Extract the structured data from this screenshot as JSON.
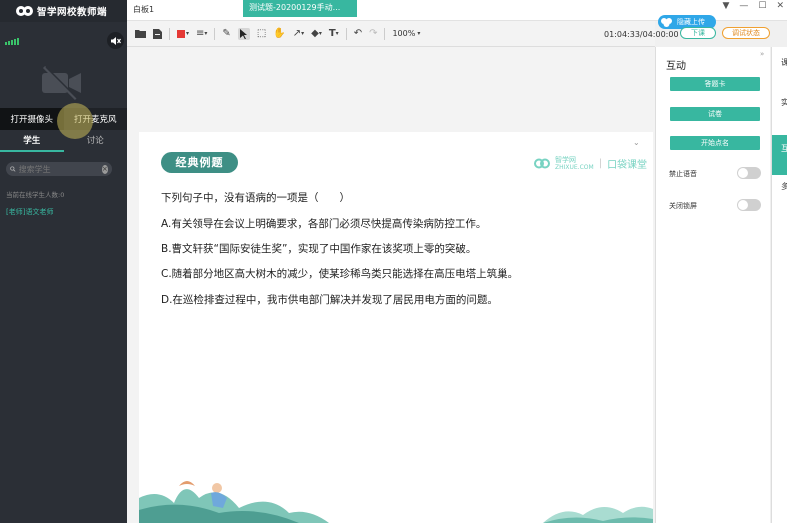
{
  "app": {
    "title": "智学网校教师端"
  },
  "left": {
    "camera_btn": "打开摄像头",
    "mic_btn": "打开麦克风",
    "tab_students": "学生",
    "tab_discuss": "讨论",
    "search_placeholder": "搜索学生",
    "online_count": "当前在线学生人数:0",
    "teacher_name": "[老师]语文老师"
  },
  "top": {
    "board_tab": "白板1",
    "file_tab": "测试题-20200129手动..."
  },
  "toolbar": {
    "zoom": "100%",
    "timer": "01:04:33/04:00:00",
    "hidden_btn": "隐藏上传",
    "download_btn": "下课",
    "status_btn": "调试状态"
  },
  "slide": {
    "badge": "经典例题",
    "brand_name": "智学网",
    "brand_sub": "ZHIXUE.COM",
    "brand_program": "口袋课堂",
    "question": "下列句子中，没有语病的一项是（　　）",
    "options": [
      "A.有关领导在会议上明确要求，各部门必须尽快提高传染病防控工作。",
      "B.曹文轩获“国际安徒生奖”，实现了中国作家在该奖项上零的突破。",
      "C.随着部分地区高大树木的减少，使某珍稀鸟类只能选择在高压电塔上筑巢。",
      "D.在巡检排查过程中，我市供电部门解决并发现了居民用电方面的问题。"
    ]
  },
  "rpanel": {
    "title": "互动",
    "btn_answer": "答题卡",
    "btn_paper": "试卷",
    "btn_rollcall": "开始点名",
    "toggle_mute": "禁止语音",
    "toggle_lock": "关闭锁屏"
  },
  "rstrip": {
    "tab1": "课件",
    "tab2": "实验",
    "tab3": "互动",
    "tab4": "多媒体"
  },
  "colors": {
    "accent": "#38b7a0",
    "pen": "#e53935",
    "dark_panel": "#2b2f36"
  }
}
